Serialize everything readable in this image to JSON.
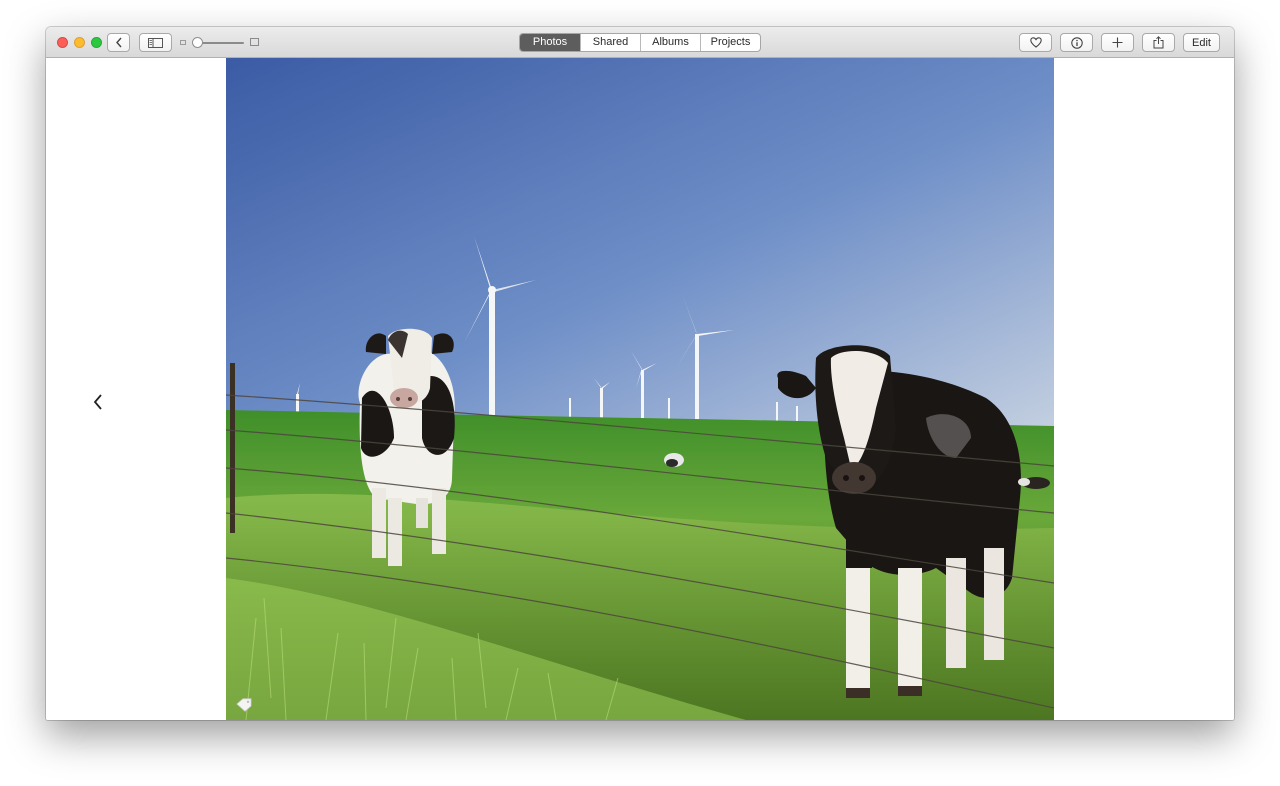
{
  "window": {
    "controls": [
      "close",
      "minimize",
      "zoom"
    ]
  },
  "toolbar": {
    "back_icon": "chevron-left-icon",
    "sidebar_icon": "sidebar-toggle-icon",
    "zoom_slider_level": 0.0,
    "tabs": [
      {
        "label": "Photos",
        "active": true
      },
      {
        "label": "Shared",
        "active": false
      },
      {
        "label": "Albums",
        "active": false
      },
      {
        "label": "Projects",
        "active": false
      }
    ],
    "favorite_icon": "heart-icon",
    "info_icon": "info-icon",
    "add_icon": "plus-icon",
    "share_icon": "share-icon",
    "edit_label": "Edit"
  },
  "viewer": {
    "prev_icon": "chevron-left-icon",
    "photo_subject": "cows-windmills-pasture",
    "tag_icon": "tag-icon"
  },
  "colors": {
    "active_tab": "#5d5d5d",
    "sky_top": "#3d5fa6",
    "sky_bottom": "#b9c8de",
    "grass": "#5a9a2c"
  }
}
